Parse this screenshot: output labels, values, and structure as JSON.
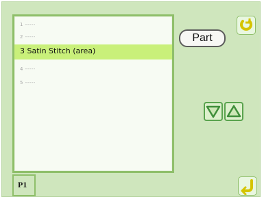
{
  "list": {
    "items": [
      {
        "label": "1 -----",
        "state": "dim"
      },
      {
        "label": "2 -----",
        "state": "dim"
      },
      {
        "label": "3 Satin Stitch (area)",
        "state": "selected"
      },
      {
        "label": "4 -----",
        "state": "dim"
      },
      {
        "label": "5 -----",
        "state": "dim"
      }
    ]
  },
  "buttons": {
    "part_label": "Part",
    "top_right_icon": "rotate-icon",
    "down_icon": "triangle-down-icon",
    "up_icon": "triangle-up-icon",
    "bottom_right_icon": "return-icon"
  },
  "tabs": [
    {
      "label": "P1"
    }
  ]
}
